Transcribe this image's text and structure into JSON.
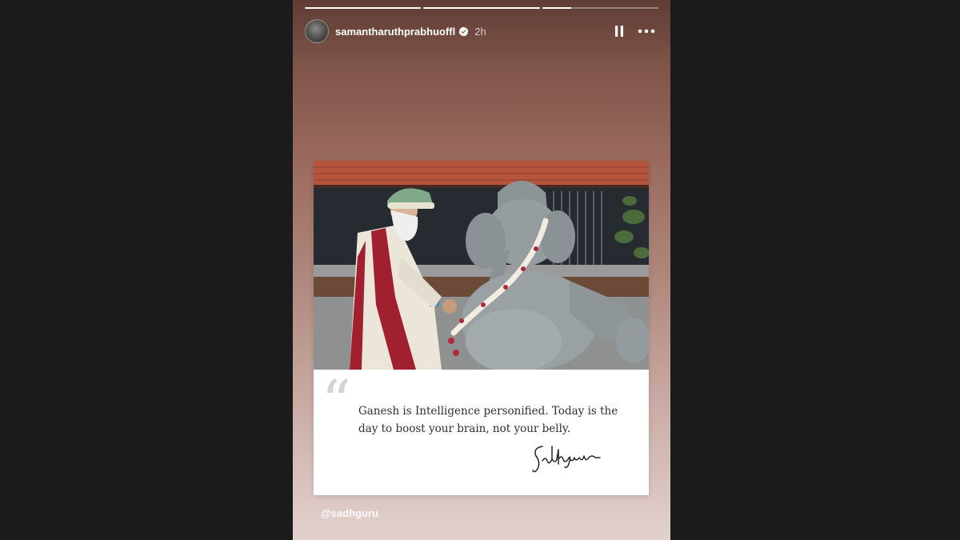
{
  "story": {
    "progress": [
      1,
      1,
      0.25
    ],
    "user": {
      "username": "samantharuthprabhuoffl",
      "verified": true,
      "time": "2h"
    },
    "controls": {
      "pause_icon": "pause-icon",
      "more_icon": "more-options-icon"
    },
    "post": {
      "photo_description_icon": "photo",
      "quote": "Ganesh is Intelligence personified. Today is the day to boost your brain, not your belly.",
      "signature": "Sadhguru"
    },
    "mention": "@sadhguru",
    "colors": {
      "verified": "#ffffff",
      "page_background": "#1b1b1b"
    }
  }
}
